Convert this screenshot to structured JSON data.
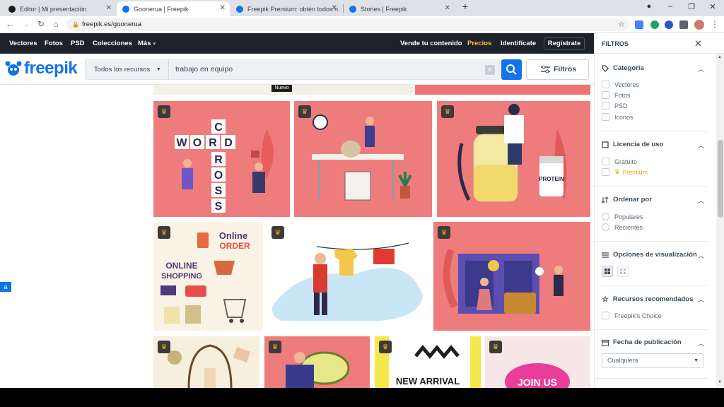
{
  "browser": {
    "tabs": [
      {
        "title": "Editor | Mi presentación",
        "active": false,
        "favicon_color": "#1a1a1a"
      },
      {
        "title": "Goonerua | Freepik",
        "active": true,
        "favicon_color": "#1273eb"
      },
      {
        "title": "Freepik Premium: obtén todos n",
        "active": false,
        "favicon_color": "#1273eb"
      },
      {
        "title": "Stories | Freepik",
        "active": false,
        "favicon_color": "#1273eb"
      }
    ],
    "new_tab": "+",
    "url": "freepik.es/goonerua",
    "window_controls": [
      "–",
      "❐",
      "✕"
    ]
  },
  "site_nav": {
    "left": [
      "Vectores",
      "Fotos",
      "PSD",
      "Colecciones",
      "Más"
    ],
    "sell": "Vende tu contenido",
    "pricing": "Precios",
    "login": "Identifícate",
    "register": "Regístrate",
    "pricing_color": "#f8c22c"
  },
  "search": {
    "logo": "freepik",
    "resource_dropdown": "Todos los recursos",
    "query": "trabajo en equipo",
    "clear": "✕",
    "filters_label": "Filtros"
  },
  "content": {
    "badge_new": "Nuevo",
    "thumbnails": [
      {
        "name": "word-cross",
        "letters": [
          "W",
          "O",
          "R",
          "D",
          "C",
          "R",
          "O",
          "S",
          "S"
        ]
      },
      {
        "name": "office-workers"
      },
      {
        "name": "protein-shake",
        "label": "PROTEIN"
      },
      {
        "name": "online-shopping",
        "label1": "ONLINE",
        "label2": "SHOPPING",
        "label3": "Online",
        "label4": "ORDER"
      },
      {
        "name": "laundry-man"
      },
      {
        "name": "locker-travel"
      },
      {
        "name": "rattan-chair"
      },
      {
        "name": "avocado-man"
      },
      {
        "name": "new-arrival",
        "label": "NEW ARRIVAL"
      },
      {
        "name": "join-us",
        "label": "JOIN US"
      }
    ]
  },
  "filters": {
    "title": "FILTROS",
    "sections": [
      {
        "title": "Categoría",
        "type": "checkbox",
        "options": [
          "Vectores",
          "Fotos",
          "PSD",
          "Iconos"
        ]
      },
      {
        "title": "Licencia de uso",
        "type": "checkbox",
        "options": [
          "Gratuito",
          "Premium"
        ]
      },
      {
        "title": "Ordenar por",
        "type": "radio",
        "options": [
          "Populares",
          "Recientes"
        ]
      },
      {
        "title": "Opciones de visualización",
        "type": "view",
        "options": []
      },
      {
        "title": "Recursos recomendados",
        "type": "checkbox",
        "options": [
          "Freepik's Choice"
        ]
      },
      {
        "title": "Fecha de publicación",
        "type": "select",
        "options": [
          "Cualquiera"
        ]
      }
    ],
    "premium_color": "#f5a623"
  }
}
